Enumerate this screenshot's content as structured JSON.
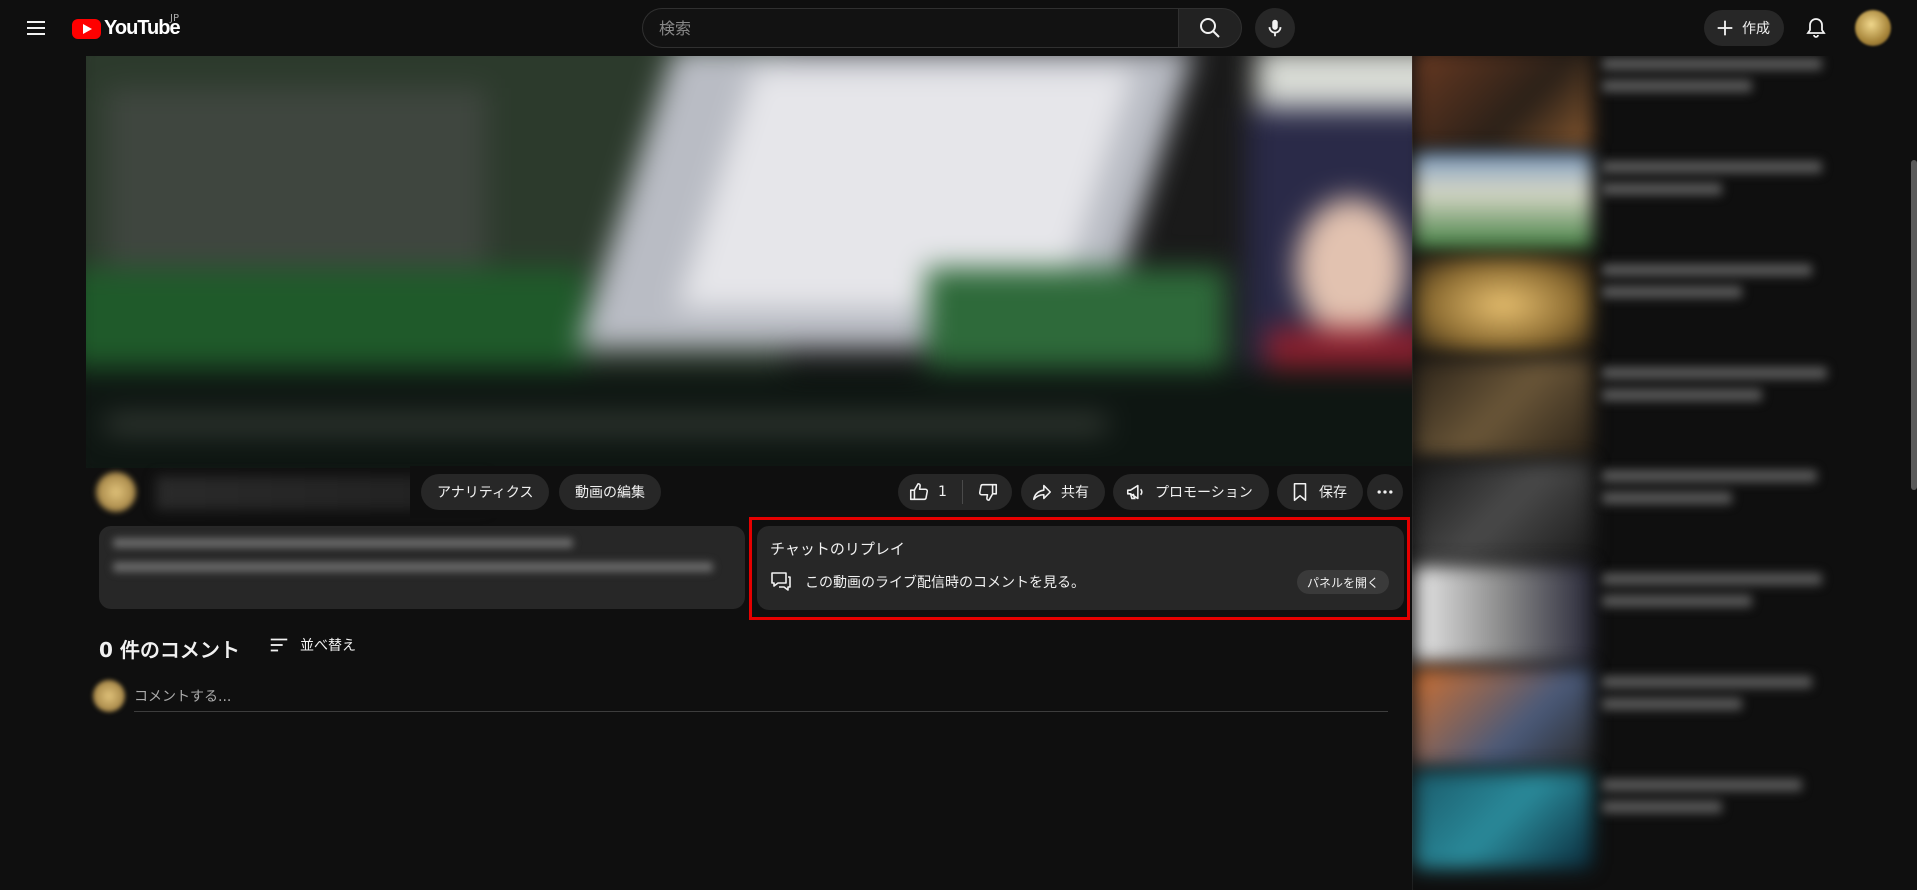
{
  "masthead": {
    "logo_text": "YouTube",
    "region": "JP",
    "search_placeholder": "検索",
    "create_label": "作成",
    "icons": [
      "menu-icon",
      "search-icon",
      "mic-icon",
      "plus-icon",
      "bell-icon"
    ]
  },
  "actions": {
    "analytics": "アナリティクス",
    "edit_video": "動画の編集",
    "like_count": "1",
    "share": "共有",
    "promotion": "プロモーション",
    "save": "保存"
  },
  "chat_replay": {
    "title": "チャットのリプレイ",
    "description": "この動画のライブ配信時のコメントを見る。",
    "open_panel": "パネルを開く"
  },
  "comments": {
    "count_label": "0 件のコメント",
    "sort_label": "並べ替え",
    "input_placeholder": "コメントする..."
  },
  "colors": {
    "background": "#0f0f0f",
    "surface": "#272727",
    "highlight": "#e60000",
    "brand": "#ff0000"
  }
}
